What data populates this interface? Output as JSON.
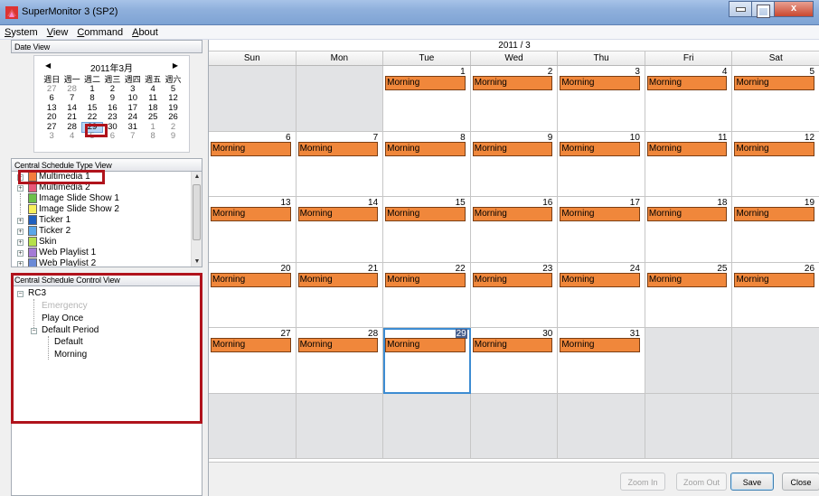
{
  "window": {
    "title": "SuperMonitor 3 (SP2)",
    "controls": {
      "minimize": "–",
      "maximize": "□",
      "close": "x"
    }
  },
  "menu": [
    {
      "prefix": "",
      "accel": "S",
      "rest": "ystem"
    },
    {
      "prefix": "",
      "accel": "V",
      "rest": "iew"
    },
    {
      "prefix": "",
      "accel": "C",
      "rest": "ommand"
    },
    {
      "prefix": "",
      "accel": "A",
      "rest": "bout"
    }
  ],
  "date_view": {
    "header": "Date View",
    "month_label": "2011年3月",
    "prev_glyph": "◀",
    "next_glyph": "▶",
    "weekday_headers": [
      "週日",
      "週一",
      "週二",
      "週三",
      "週四",
      "週五",
      "週六"
    ],
    "weeks": [
      [
        {
          "d": "27",
          "dim": true
        },
        {
          "d": "28",
          "dim": true
        },
        {
          "d": "1"
        },
        {
          "d": "2"
        },
        {
          "d": "3"
        },
        {
          "d": "4"
        },
        {
          "d": "5"
        }
      ],
      [
        {
          "d": "6"
        },
        {
          "d": "7"
        },
        {
          "d": "8"
        },
        {
          "d": "9"
        },
        {
          "d": "10"
        },
        {
          "d": "11"
        },
        {
          "d": "12"
        }
      ],
      [
        {
          "d": "13"
        },
        {
          "d": "14"
        },
        {
          "d": "15"
        },
        {
          "d": "16"
        },
        {
          "d": "17"
        },
        {
          "d": "18"
        },
        {
          "d": "19"
        }
      ],
      [
        {
          "d": "20"
        },
        {
          "d": "21"
        },
        {
          "d": "22"
        },
        {
          "d": "23"
        },
        {
          "d": "24"
        },
        {
          "d": "25"
        },
        {
          "d": "26"
        }
      ],
      [
        {
          "d": "27"
        },
        {
          "d": "28"
        },
        {
          "d": "29",
          "today": true
        },
        {
          "d": "30"
        },
        {
          "d": "31"
        },
        {
          "d": "1",
          "dim": true
        },
        {
          "d": "2",
          "dim": true
        }
      ],
      [
        {
          "d": "3",
          "dim": true
        },
        {
          "d": "4",
          "dim": true
        },
        {
          "d": "5",
          "dim": true
        },
        {
          "d": "6",
          "dim": true
        },
        {
          "d": "7",
          "dim": true
        },
        {
          "d": "8",
          "dim": true
        },
        {
          "d": "9",
          "dim": true
        }
      ]
    ]
  },
  "type_view": {
    "header": "Central Schedule Type View",
    "items": [
      {
        "label": "Multimedia 1",
        "color": "#f47c3c",
        "expandable": true
      },
      {
        "label": "Multimedia 2",
        "color": "#e8587a",
        "expandable": true
      },
      {
        "label": "Image Slide Show 1",
        "color": "#6cc04a",
        "expandable": false
      },
      {
        "label": "Image Slide Show 2",
        "color": "#f7ef5b",
        "expandable": false
      },
      {
        "label": "Ticker 1",
        "color": "#1f5fbf",
        "expandable": true
      },
      {
        "label": "Ticker 2",
        "color": "#5aa6e8",
        "expandable": true
      },
      {
        "label": "Skin",
        "color": "#b5e04a",
        "expandable": true
      },
      {
        "label": "Web Playlist 1",
        "color": "#a47ad6",
        "expandable": true
      },
      {
        "label": "Web Playlist 2",
        "color": "#6a8ad6",
        "expandable": true
      }
    ]
  },
  "control_view": {
    "header": "Central Schedule Control View",
    "root": "RC3",
    "emergency": "Emergency",
    "play_once": "Play Once",
    "default_period": "Default Period",
    "default": "Default",
    "morning": "Morning"
  },
  "calendar": {
    "month_header": "2011 / 3",
    "days_of_week": [
      "Sun",
      "Mon",
      "Tue",
      "Wed",
      "Thu",
      "Fri",
      "Sat"
    ],
    "weeks": [
      [
        {
          "n": "",
          "out": true
        },
        {
          "n": "",
          "out": true
        },
        {
          "n": "1",
          "ev": "Morning"
        },
        {
          "n": "2",
          "ev": "Morning"
        },
        {
          "n": "3",
          "ev": "Morning"
        },
        {
          "n": "4",
          "ev": "Morning"
        },
        {
          "n": "5",
          "ev": "Morning"
        }
      ],
      [
        {
          "n": "6",
          "ev": "Morning"
        },
        {
          "n": "7",
          "ev": "Morning"
        },
        {
          "n": "8",
          "ev": "Morning"
        },
        {
          "n": "9",
          "ev": "Morning"
        },
        {
          "n": "10",
          "ev": "Morning"
        },
        {
          "n": "11",
          "ev": "Morning"
        },
        {
          "n": "12",
          "ev": "Morning"
        }
      ],
      [
        {
          "n": "13",
          "ev": "Morning"
        },
        {
          "n": "14",
          "ev": "Morning"
        },
        {
          "n": "15",
          "ev": "Morning"
        },
        {
          "n": "16",
          "ev": "Morning"
        },
        {
          "n": "17",
          "ev": "Morning"
        },
        {
          "n": "18",
          "ev": "Morning"
        },
        {
          "n": "19",
          "ev": "Morning"
        }
      ],
      [
        {
          "n": "20",
          "ev": "Morning"
        },
        {
          "n": "21",
          "ev": "Morning"
        },
        {
          "n": "22",
          "ev": "Morning"
        },
        {
          "n": "23",
          "ev": "Morning"
        },
        {
          "n": "24",
          "ev": "Morning"
        },
        {
          "n": "25",
          "ev": "Morning"
        },
        {
          "n": "26",
          "ev": "Morning"
        }
      ],
      [
        {
          "n": "27",
          "ev": "Morning"
        },
        {
          "n": "28",
          "ev": "Morning"
        },
        {
          "n": "29",
          "ev": "Morning",
          "selected": true
        },
        {
          "n": "30",
          "ev": "Morning"
        },
        {
          "n": "31",
          "ev": "Morning"
        },
        {
          "n": "",
          "out": true
        },
        {
          "n": "",
          "out": true
        }
      ],
      [
        {
          "n": "",
          "out": true
        },
        {
          "n": "",
          "out": true
        },
        {
          "n": "",
          "out": true
        },
        {
          "n": "",
          "out": true
        },
        {
          "n": "",
          "out": true
        },
        {
          "n": "",
          "out": true
        },
        {
          "n": "",
          "out": true
        }
      ]
    ],
    "event_color": "#f0873b",
    "selected_color": "#3d8cd2"
  },
  "buttons": {
    "zoom_in": "Zoom In",
    "zoom_out": "Zoom Out",
    "save": "Save",
    "close": "Close"
  },
  "colors": {
    "highlight_red": "#b0131c"
  }
}
